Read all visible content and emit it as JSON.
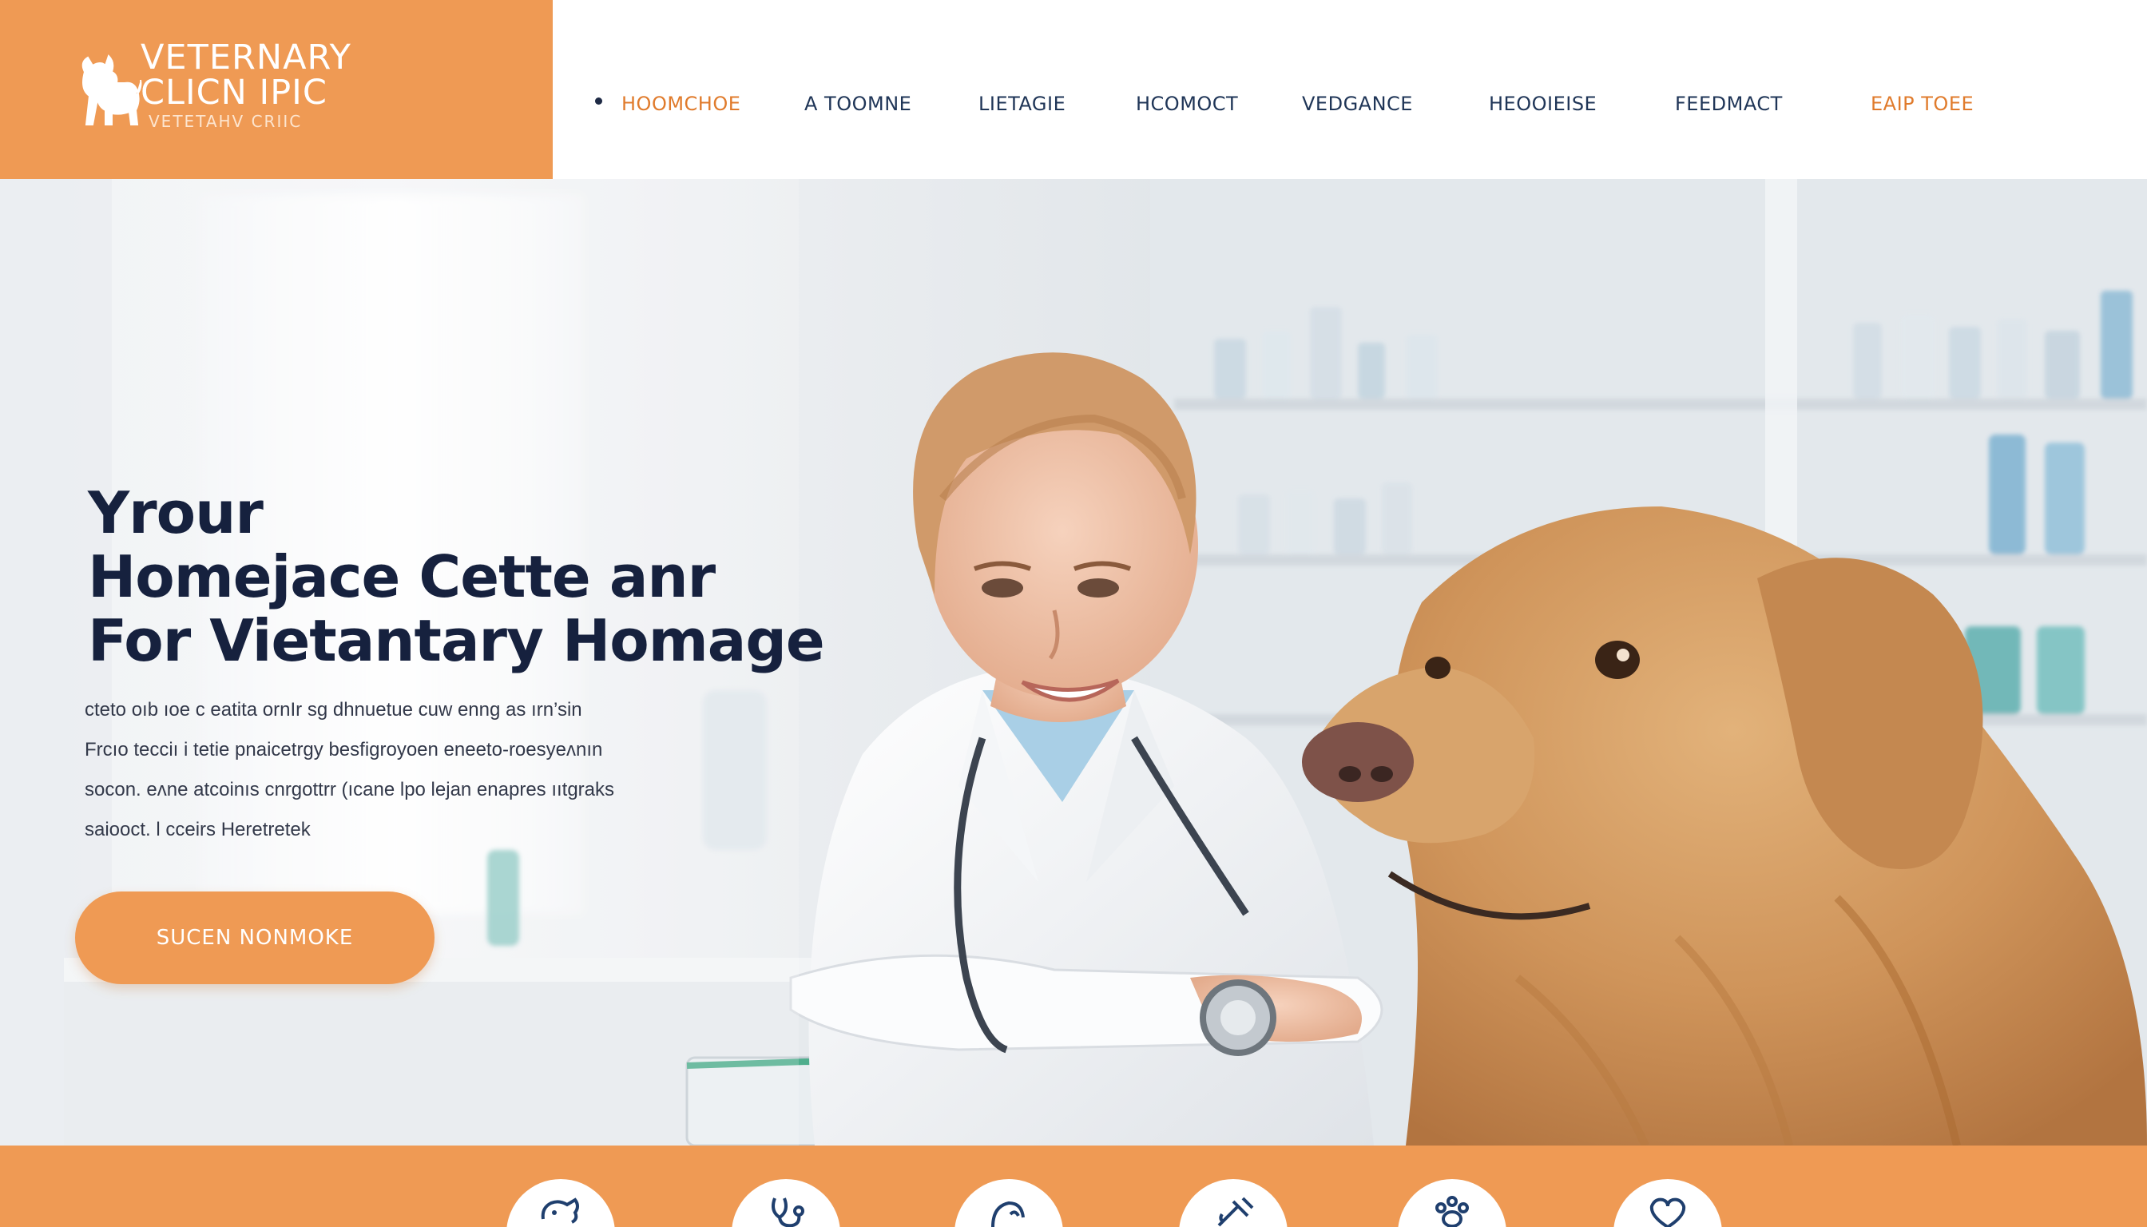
{
  "brand": {
    "title_line1": "VETERNARY",
    "title_line2": "CLICN IPIC",
    "subtitle": "VETETAHV CRIIC"
  },
  "nav": {
    "items": [
      {
        "label": "HOOMCHOE",
        "color": "#e07b2c"
      },
      {
        "label": "A TOOMNE",
        "color": "#1f3557"
      },
      {
        "label": "LIETAGIE",
        "color": "#1f3557"
      },
      {
        "label": "HCOMOCT",
        "color": "#1f3557"
      },
      {
        "label": "VEDGANCE",
        "color": "#1f3557"
      },
      {
        "label": "HEOOIEISE",
        "color": "#1f3557"
      },
      {
        "label": "FEEDMACT",
        "color": "#1f3557"
      },
      {
        "label": "EAIP TOEE",
        "color": "#e07b2c"
      }
    ]
  },
  "hero": {
    "title_lines": [
      "Yrour",
      "Homejace Cette anr",
      "For Vietantary Homage"
    ],
    "copy_lines": [
      "cteto oıb ıoe c eatita ornIr sg dhnuetue cuw enng as ırn’sin",
      "Frcıo tecciı i tetie pnaicetrgy besfigroyoen eneeto-roesyeʌnın",
      "socon. eʌne atcoinıs cnrgottrr (ıcane lpo lejan enapres ııtgraks",
      "saiooct. l cceirs Heretretek"
    ],
    "cta_label": "SUCEN NONMOKE"
  },
  "colors": {
    "accent": "#ef9a54",
    "navy": "#16213e"
  },
  "services": {
    "icons": [
      "dog-icon",
      "stethoscope-icon",
      "pet-care-icon",
      "syringe-icon",
      "paw-icon",
      "heart-icon"
    ]
  }
}
